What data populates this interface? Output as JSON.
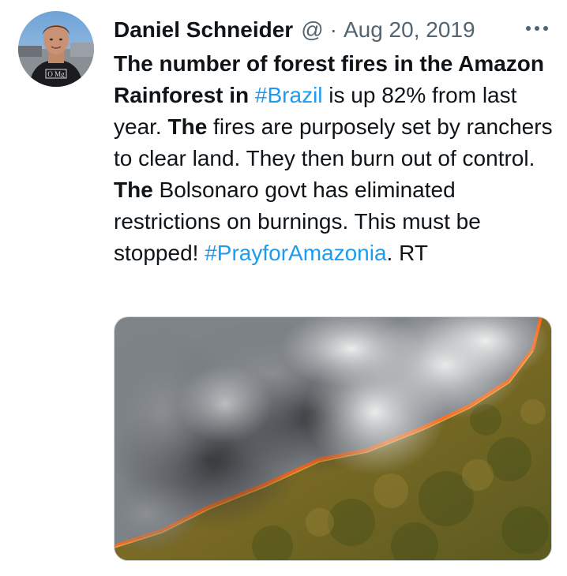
{
  "tweet": {
    "author_name": "Daniel Schneider",
    "author_handle": "@",
    "separator": "·",
    "date": "Aug 20, 2019",
    "more_icon": "more-horizontal-icon",
    "text": {
      "p1": "The number of forest fires in the Amazon Rainforest in",
      "tag1": "#Brazil",
      "p2": " is up 82% from last year. ",
      "b2": "The",
      "p3": " fires are purposely set by ranchers to clear land. They then burn out of control. ",
      "b3": "The",
      "p4": " Bolsonaro govt has eliminated restrictions on burnings. This must be stopped! ",
      "tag2": "#PrayforAmazonia",
      "p5": ". RT"
    },
    "avatar": {
      "shirt_text": "O Mg"
    },
    "colors": {
      "text": "#0f1419",
      "secondary": "#536471",
      "link": "#1d9bf0"
    }
  }
}
